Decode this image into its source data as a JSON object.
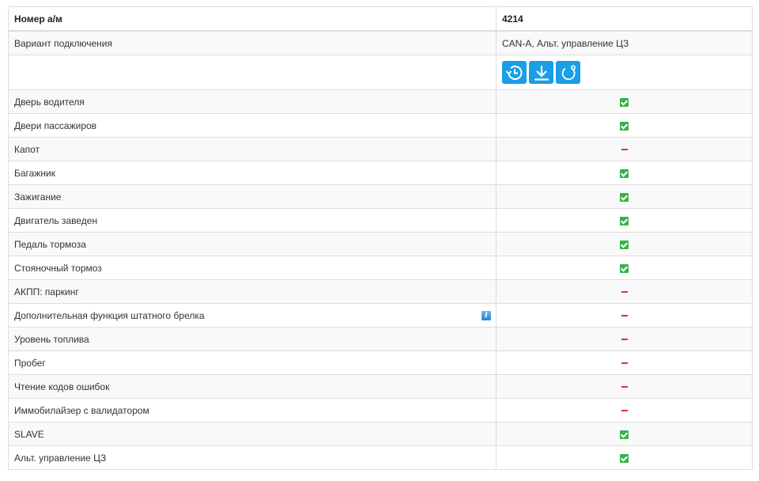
{
  "header": {
    "label": "Номер а/м",
    "value": "4214"
  },
  "connection": {
    "label": "Вариант подключения",
    "value": "CAN-A, Альт. управление ЦЗ"
  },
  "actions": [
    {
      "icon": "history-icon"
    },
    {
      "icon": "download-icon"
    },
    {
      "icon": "refresh-icon"
    }
  ],
  "rows": [
    {
      "label": "Дверь водителя",
      "supported": true
    },
    {
      "label": "Двери пассажиров",
      "supported": true
    },
    {
      "label": "Капот",
      "supported": false
    },
    {
      "label": "Багажник",
      "supported": true
    },
    {
      "label": "Зажигание",
      "supported": true
    },
    {
      "label": "Двигатель заведен",
      "supported": true
    },
    {
      "label": "Педаль тормоза",
      "supported": true
    },
    {
      "label": "Стояночный тормоз",
      "supported": true
    },
    {
      "label": "АКПП: паркинг",
      "supported": false
    },
    {
      "label": "Дополнительная функция штатного брелка",
      "supported": false,
      "info": true
    },
    {
      "label": "Уровень топлива",
      "supported": false
    },
    {
      "label": "Пробег",
      "supported": false
    },
    {
      "label": "Чтение кодов ошибок",
      "supported": false
    },
    {
      "label": "Иммобилайзер с валидатором",
      "supported": false
    },
    {
      "label": "SLAVE",
      "supported": true
    },
    {
      "label": "Альт. управление ЦЗ",
      "supported": true
    }
  ],
  "colors": {
    "check": "#36b34a",
    "dash": "#d9332b",
    "button": "#1a9ee6"
  }
}
